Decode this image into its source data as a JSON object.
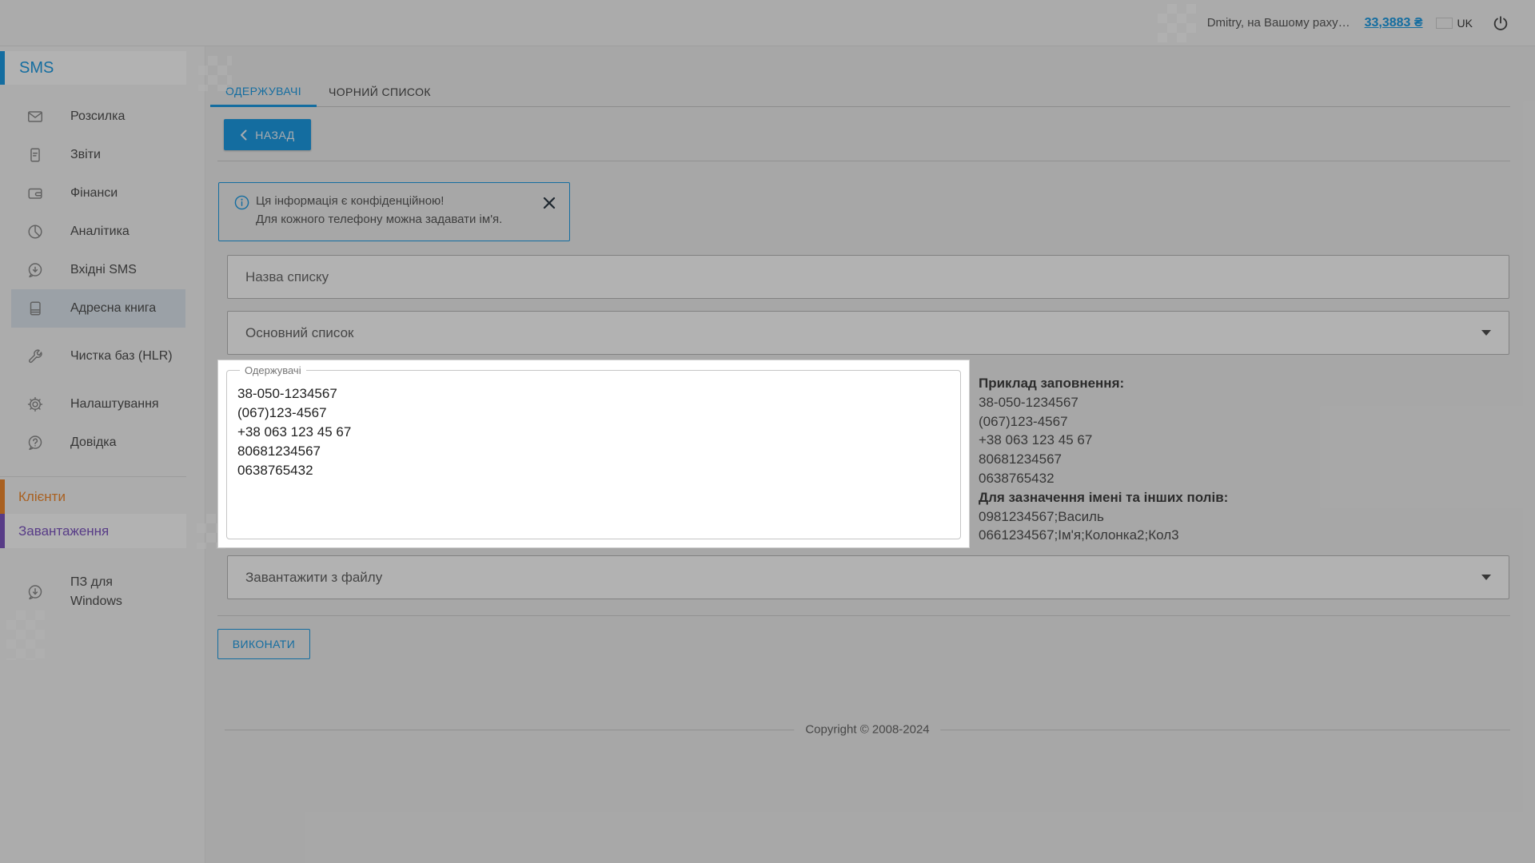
{
  "header": {
    "greeting": "Dmitry, на Вашому раху…",
    "balance": "33,3883 ₴",
    "language": "UK"
  },
  "sidebar": {
    "sms_section": "SMS",
    "items": [
      {
        "label": "Розсилка",
        "icon": "mail-icon"
      },
      {
        "label": "Звіти",
        "icon": "report-icon"
      },
      {
        "label": "Фінанси",
        "icon": "wallet-icon"
      },
      {
        "label": "Аналітика",
        "icon": "pie-chart-icon"
      },
      {
        "label": "Вхідні SMS",
        "icon": "incoming-sms-icon"
      },
      {
        "label": "Адресна книга",
        "icon": "address-book-icon",
        "selected": true
      },
      {
        "label": "Чистка баз (HLR)",
        "icon": "wrench-icon"
      },
      {
        "label": "Налаштування",
        "icon": "gear-icon"
      },
      {
        "label": "Довідка",
        "icon": "help-icon"
      }
    ],
    "clients_section": "Клієнти",
    "downloads_section": "Завантаження",
    "windows_item": "ПЗ для Windows"
  },
  "tabs": {
    "recipients": "ОДЕРЖУВАЧІ",
    "blacklist": "ЧОРНИЙ СПИСОК"
  },
  "toolbar": {
    "back_label": "НАЗАД"
  },
  "notice": {
    "line1": "Ця інформація є конфіденційною!",
    "line2": "Для кожного телефону можна задавати ім'я."
  },
  "form": {
    "list_name_placeholder": "Назва списку",
    "list_select_value": "Основний список",
    "recipients_label": "Одержувачі",
    "recipients_value": "38-050-1234567\n(067)123-4567\n+38 063 123 45 67\n80681234567\n0638765432",
    "file_select_value": "Завантажити з файлу",
    "submit_label": "ВИКОНАТИ"
  },
  "example_panel": {
    "fill_title": "Приклад заповнення:",
    "fill_lines": [
      "38-050-1234567",
      "(067)123-4567",
      "+38 063 123 45 67",
      "80681234567",
      "0638765432"
    ],
    "fields_title": "Для зазначення імені та інших полів:",
    "fields_lines": [
      "0981234567;Василь",
      "0661234567;Ім'я;Колонка2;Кол3"
    ]
  },
  "footer": {
    "copyright": "Copyright © 2008-2024"
  },
  "colors": {
    "accent": "#1e9de6",
    "clients_orange": "#f28a2e",
    "downloads_purple": "#7e57c2",
    "flag_blue": "#005bbb",
    "flag_yellow": "#ffd500"
  }
}
